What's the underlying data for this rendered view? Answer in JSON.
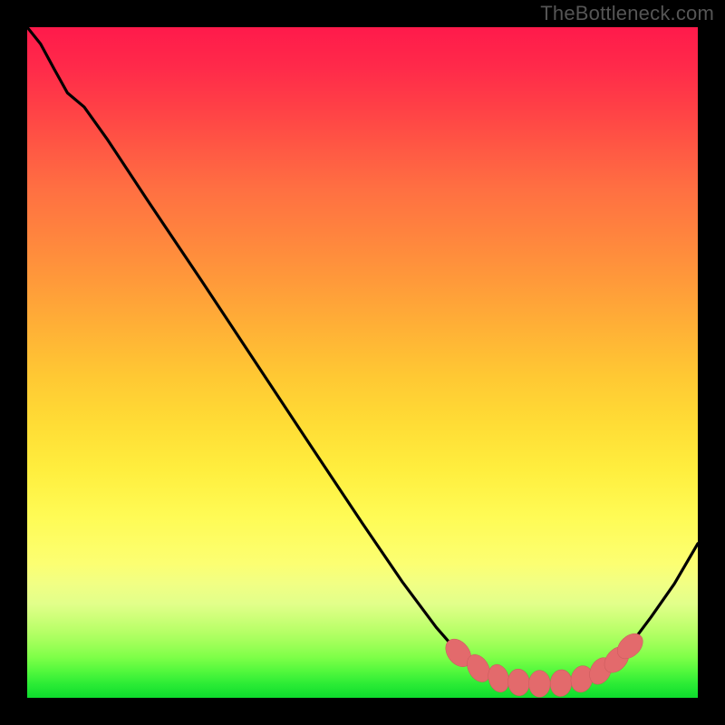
{
  "watermark": "TheBottleneck.com",
  "colors": {
    "background": "#000000",
    "curve": "#000000",
    "dot_fill": "#e36a6c",
    "dot_stroke": "#c85a5c",
    "watermark": "#555555",
    "gradient_top": "#ff1a4b",
    "gradient_bottom": "#0edc2d"
  },
  "chart_data": {
    "type": "line",
    "title": "",
    "xlabel": "",
    "ylabel": "",
    "xlim": [
      0,
      100
    ],
    "ylim": [
      0,
      100
    ],
    "grid": false,
    "legend": false,
    "annotations": [],
    "curve_points": [
      {
        "x": 0.0,
        "y": 100.0
      },
      {
        "x": 2.0,
        "y": 97.5
      },
      {
        "x": 4.0,
        "y": 93.8
      },
      {
        "x": 6.0,
        "y": 90.2
      },
      {
        "x": 8.5,
        "y": 88.1
      },
      {
        "x": 12.0,
        "y": 83.2
      },
      {
        "x": 18.0,
        "y": 74.1
      },
      {
        "x": 26.0,
        "y": 62.2
      },
      {
        "x": 34.0,
        "y": 50.1
      },
      {
        "x": 42.0,
        "y": 38.0
      },
      {
        "x": 50.0,
        "y": 26.0
      },
      {
        "x": 56.0,
        "y": 17.2
      },
      {
        "x": 61.0,
        "y": 10.5
      },
      {
        "x": 64.5,
        "y": 6.5
      },
      {
        "x": 67.5,
        "y": 4.1
      },
      {
        "x": 71.0,
        "y": 2.7
      },
      {
        "x": 74.0,
        "y": 2.2
      },
      {
        "x": 77.5,
        "y": 2.1
      },
      {
        "x": 81.0,
        "y": 2.4
      },
      {
        "x": 84.0,
        "y": 3.2
      },
      {
        "x": 87.0,
        "y": 5.0
      },
      {
        "x": 90.0,
        "y": 8.0
      },
      {
        "x": 93.0,
        "y": 12.0
      },
      {
        "x": 96.5,
        "y": 17.0
      },
      {
        "x": 100.0,
        "y": 23.0
      }
    ],
    "markers": [
      {
        "cx": 64.3,
        "cy": 6.7,
        "rx": 1.6,
        "ry": 2.3,
        "rot": -38
      },
      {
        "cx": 67.3,
        "cy": 4.4,
        "rx": 1.5,
        "ry": 2.2,
        "rot": -30
      },
      {
        "cx": 70.3,
        "cy": 2.9,
        "rx": 1.5,
        "ry": 2.1,
        "rot": -16
      },
      {
        "cx": 73.3,
        "cy": 2.3,
        "rx": 1.6,
        "ry": 2.0,
        "rot": -6
      },
      {
        "cx": 76.4,
        "cy": 2.1,
        "rx": 1.6,
        "ry": 2.0,
        "rot": 0
      },
      {
        "cx": 79.6,
        "cy": 2.2,
        "rx": 1.6,
        "ry": 2.0,
        "rot": 6
      },
      {
        "cx": 82.7,
        "cy": 2.8,
        "rx": 1.6,
        "ry": 2.0,
        "rot": 14
      },
      {
        "cx": 85.5,
        "cy": 4.0,
        "rx": 1.5,
        "ry": 2.1,
        "rot": 27
      },
      {
        "cx": 87.9,
        "cy": 5.7,
        "rx": 1.5,
        "ry": 2.2,
        "rot": 40
      },
      {
        "cx": 89.9,
        "cy": 7.7,
        "rx": 1.5,
        "ry": 2.2,
        "rot": 46
      }
    ]
  }
}
